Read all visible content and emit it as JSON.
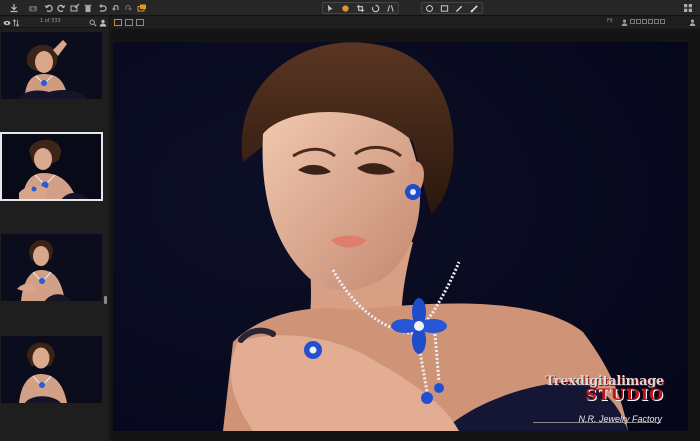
{
  "colors": {
    "accent": "#e0962a",
    "selection_border": "#e8e8e8",
    "background": "#07081a"
  },
  "toolbar": {
    "left_icons": [
      "import-icon",
      "camera-icon",
      "rotate-left-icon",
      "rotate-right-icon",
      "edit-icon",
      "delete-icon",
      "undo-icon",
      "redo-icon",
      "layers-icon"
    ],
    "tool_group_1": [
      "cursor-icon",
      "pan-icon",
      "crop-icon",
      "straighten-icon",
      "heal-icon"
    ],
    "tool_group_2": [
      "circle-icon",
      "rect-icon",
      "brush-icon",
      "eraser-icon"
    ]
  },
  "filmstrip": {
    "counter": "1 of 333",
    "thumbnails": [
      {
        "selected": false
      },
      {
        "selected": true
      },
      {
        "selected": false
      },
      {
        "selected": false
      }
    ]
  },
  "viewer": {
    "fit_label": "Fit",
    "watermark_line1": "Trexdigitalimage",
    "watermark_line2": "STUDIO",
    "credit": "N.R. Jewelry Factory"
  }
}
